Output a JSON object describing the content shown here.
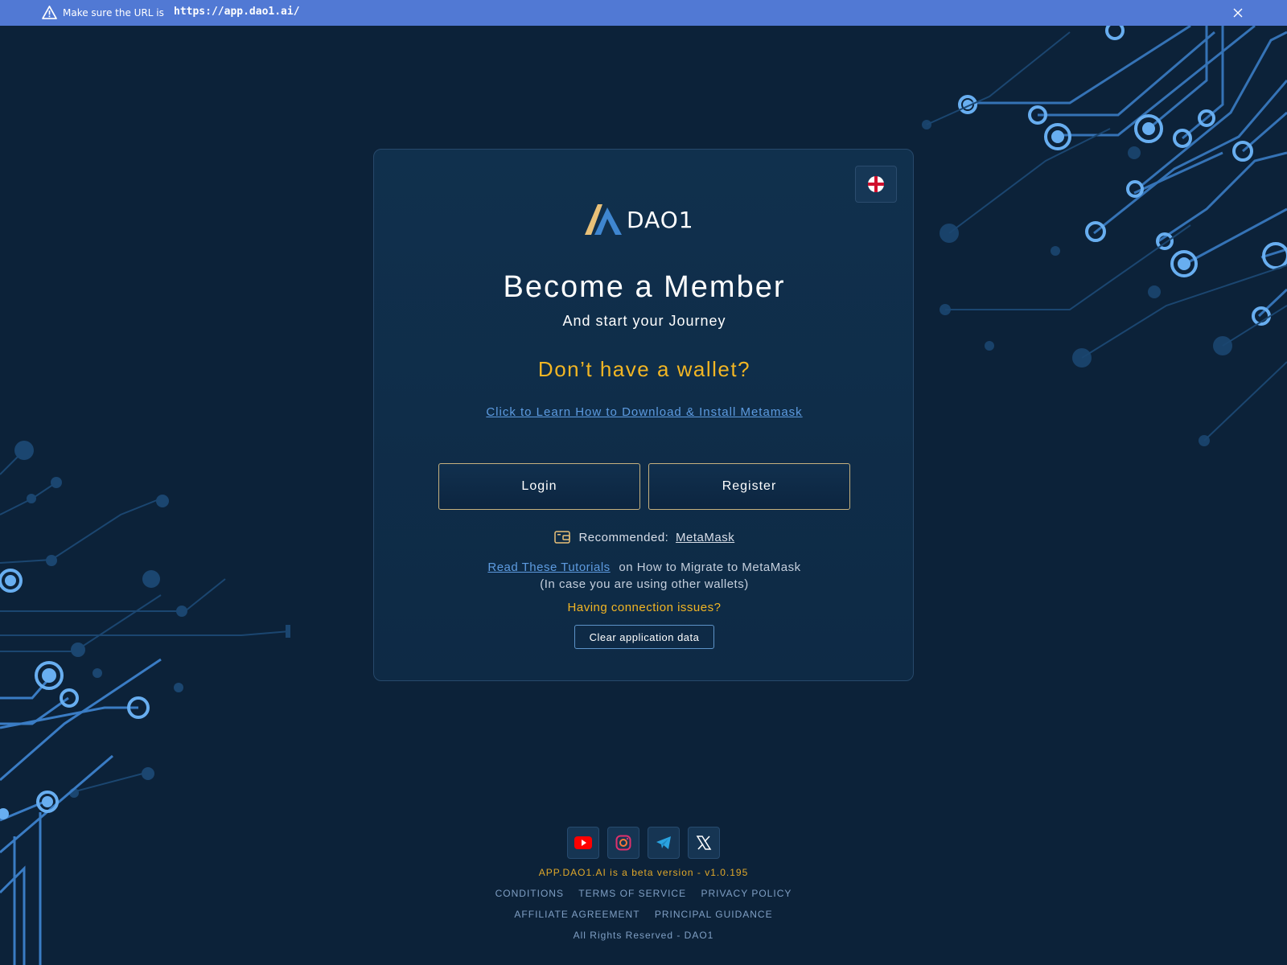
{
  "banner": {
    "text": "Make sure the URL is",
    "url": "https://app.dao1.ai/",
    "warning_icon": "warning-icon",
    "close_icon": "close-icon"
  },
  "brand": {
    "logo_text": "DAO1",
    "gold": "#e8c078",
    "blue": "#3f86d0"
  },
  "language": {
    "icon": "england-flag-icon"
  },
  "card": {
    "title": "Become a Member",
    "subtitle": "And start your Journey",
    "no_wallet": "Don’t have a wallet?",
    "learn_link": "Click to Learn How to Download & Install Metamask",
    "login_label": "Login",
    "register_label": "Register",
    "recommended_label": "Recommended:",
    "recommended_link": "MetaMask",
    "tutorials_link": "Read These Tutorials",
    "tutorials_text": "on How to Migrate to MetaMask",
    "tutorials_note": "(In case you are using other wallets)",
    "issues_text": "Having connection issues?",
    "clear_label": "Clear application data"
  },
  "footer": {
    "socials": [
      "youtube-icon",
      "instagram-icon",
      "telegram-icon",
      "x-icon"
    ],
    "beta": "APP.DAO1.AI is a beta version - v1.0.195",
    "links_row1": [
      "CONDITIONS",
      "TERMS OF SERVICE",
      "PRIVACY POLICY"
    ],
    "links_row2": [
      "AFFILIATE AGREEMENT",
      "PRINCIPAL GUIDANCE"
    ],
    "rights": "All Rights Reserved - DAO1"
  },
  "colors": {
    "background": "#0c2239",
    "banner": "#5179d4",
    "accent_yellow": "#f2b624",
    "link_blue": "#5d9be0",
    "circuit": "#4f97e0"
  }
}
